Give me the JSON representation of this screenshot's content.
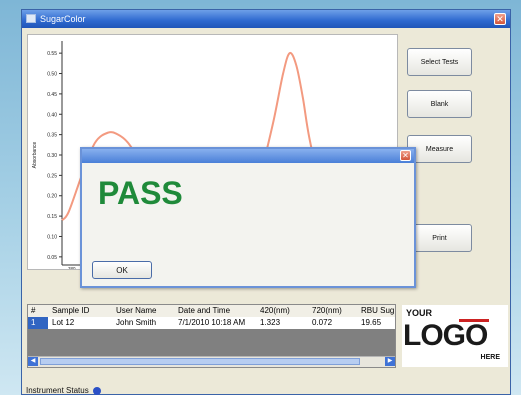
{
  "window": {
    "title": "SugarColor"
  },
  "sidebar": {
    "select_tests": "Select Tests",
    "blank": "Blank",
    "measure": "Measure",
    "print": "Print"
  },
  "chart_data": {
    "type": "line",
    "ylabel": "Absorbance",
    "yticks": [
      "0.55",
      "0.50",
      "0.45",
      "0.40",
      "0.35",
      "0.30",
      "0.25",
      "0.20",
      "0.15",
      "0.10",
      "0.05"
    ],
    "xtick_first": "380",
    "ylim": [
      0.03,
      0.57
    ],
    "xlim": [
      0,
      100
    ],
    "series": [
      {
        "color": "#f39a80",
        "x": [
          0,
          2,
          6,
          10,
          14,
          17,
          20,
          24,
          28,
          34,
          40,
          46,
          52,
          56,
          60,
          64,
          67,
          69,
          71,
          73,
          75,
          79,
          83,
          88,
          94,
          100
        ],
        "y": [
          0.14,
          0.16,
          0.25,
          0.33,
          0.355,
          0.35,
          0.33,
          0.28,
          0.22,
          0.15,
          0.1,
          0.09,
          0.11,
          0.16,
          0.25,
          0.38,
          0.5,
          0.55,
          0.52,
          0.44,
          0.34,
          0.2,
          0.12,
          0.09,
          0.085,
          0.08
        ]
      }
    ]
  },
  "table": {
    "columns": [
      "#",
      "Sample ID",
      "User Name",
      "Date and Time",
      "420(nm)",
      "720(nm)",
      "RBU Sug"
    ],
    "rows": [
      [
        "1",
        "Lot 12",
        "John Smith",
        "7/1/2010 10:18 AM",
        "1.323",
        "0.072",
        "19.65"
      ]
    ]
  },
  "logo": {
    "top": "YOUR",
    "main": "LOGO",
    "bottom": "HERE"
  },
  "status": {
    "label": "Instrument Status"
  },
  "dialog": {
    "message": "PASS",
    "ok_label": "OK"
  }
}
